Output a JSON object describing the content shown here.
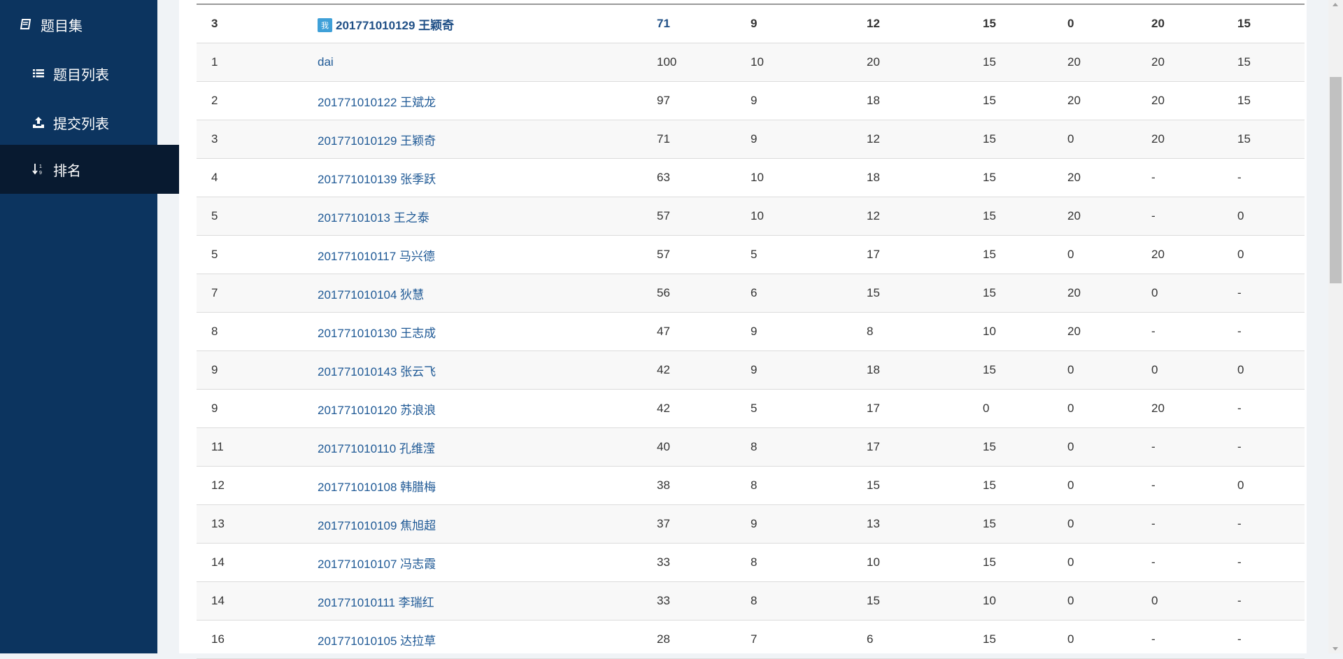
{
  "sidebar": {
    "items": [
      {
        "label": "题目集",
        "icon": "book-icon"
      },
      {
        "label": "题目列表",
        "icon": "list-icon"
      },
      {
        "label": "提交列表",
        "icon": "upload-icon"
      },
      {
        "label": "排名",
        "icon": "sort-numeric-icon"
      }
    ],
    "active_color": "#3fb0e8"
  },
  "ranking": {
    "me_badge": "我",
    "rows": [
      [
        "3",
        "201771010129 王颖奇",
        "71",
        "9",
        "12",
        "15",
        "0",
        "20",
        "15"
      ],
      [
        "1",
        "dai",
        "100",
        "10",
        "20",
        "15",
        "20",
        "20",
        "15"
      ],
      [
        "2",
        "201771010122 王斌龙",
        "97",
        "9",
        "18",
        "15",
        "20",
        "20",
        "15"
      ],
      [
        "3",
        "201771010129 王颖奇",
        "71",
        "9",
        "12",
        "15",
        "0",
        "20",
        "15"
      ],
      [
        "4",
        "201771010139 张季跃",
        "63",
        "10",
        "18",
        "15",
        "20",
        "-",
        "-"
      ],
      [
        "5",
        "20177101013 王之泰",
        "57",
        "10",
        "12",
        "15",
        "20",
        "-",
        "0"
      ],
      [
        "5",
        "201771010117 马兴德",
        "57",
        "5",
        "17",
        "15",
        "0",
        "20",
        "0"
      ],
      [
        "7",
        "201771010104 狄慧",
        "56",
        "6",
        "15",
        "15",
        "20",
        "0",
        "-"
      ],
      [
        "8",
        "201771010130 王志成",
        "47",
        "9",
        "8",
        "10",
        "20",
        "-",
        "-"
      ],
      [
        "9",
        "201771010143 张云飞",
        "42",
        "9",
        "18",
        "15",
        "0",
        "0",
        "0"
      ],
      [
        "9",
        "201771010120 苏浪浪",
        "42",
        "5",
        "17",
        "0",
        "0",
        "20",
        "-"
      ],
      [
        "11",
        "201771010110 孔维滢",
        "40",
        "8",
        "17",
        "15",
        "0",
        "-",
        "-"
      ],
      [
        "12",
        "201771010108 韩腊梅",
        "38",
        "8",
        "15",
        "15",
        "0",
        "-",
        "0"
      ],
      [
        "13",
        "201771010109 焦旭超",
        "37",
        "9",
        "13",
        "15",
        "0",
        "-",
        "-"
      ],
      [
        "14",
        "201771010107 冯志霞",
        "33",
        "8",
        "10",
        "15",
        "0",
        "-",
        "-"
      ],
      [
        "14",
        "201771010111 李瑞红",
        "33",
        "8",
        "15",
        "10",
        "0",
        "0",
        "-"
      ],
      [
        "16",
        "201771010105 达拉草",
        "28",
        "7",
        "6",
        "15",
        "0",
        "-",
        "-"
      ]
    ]
  }
}
